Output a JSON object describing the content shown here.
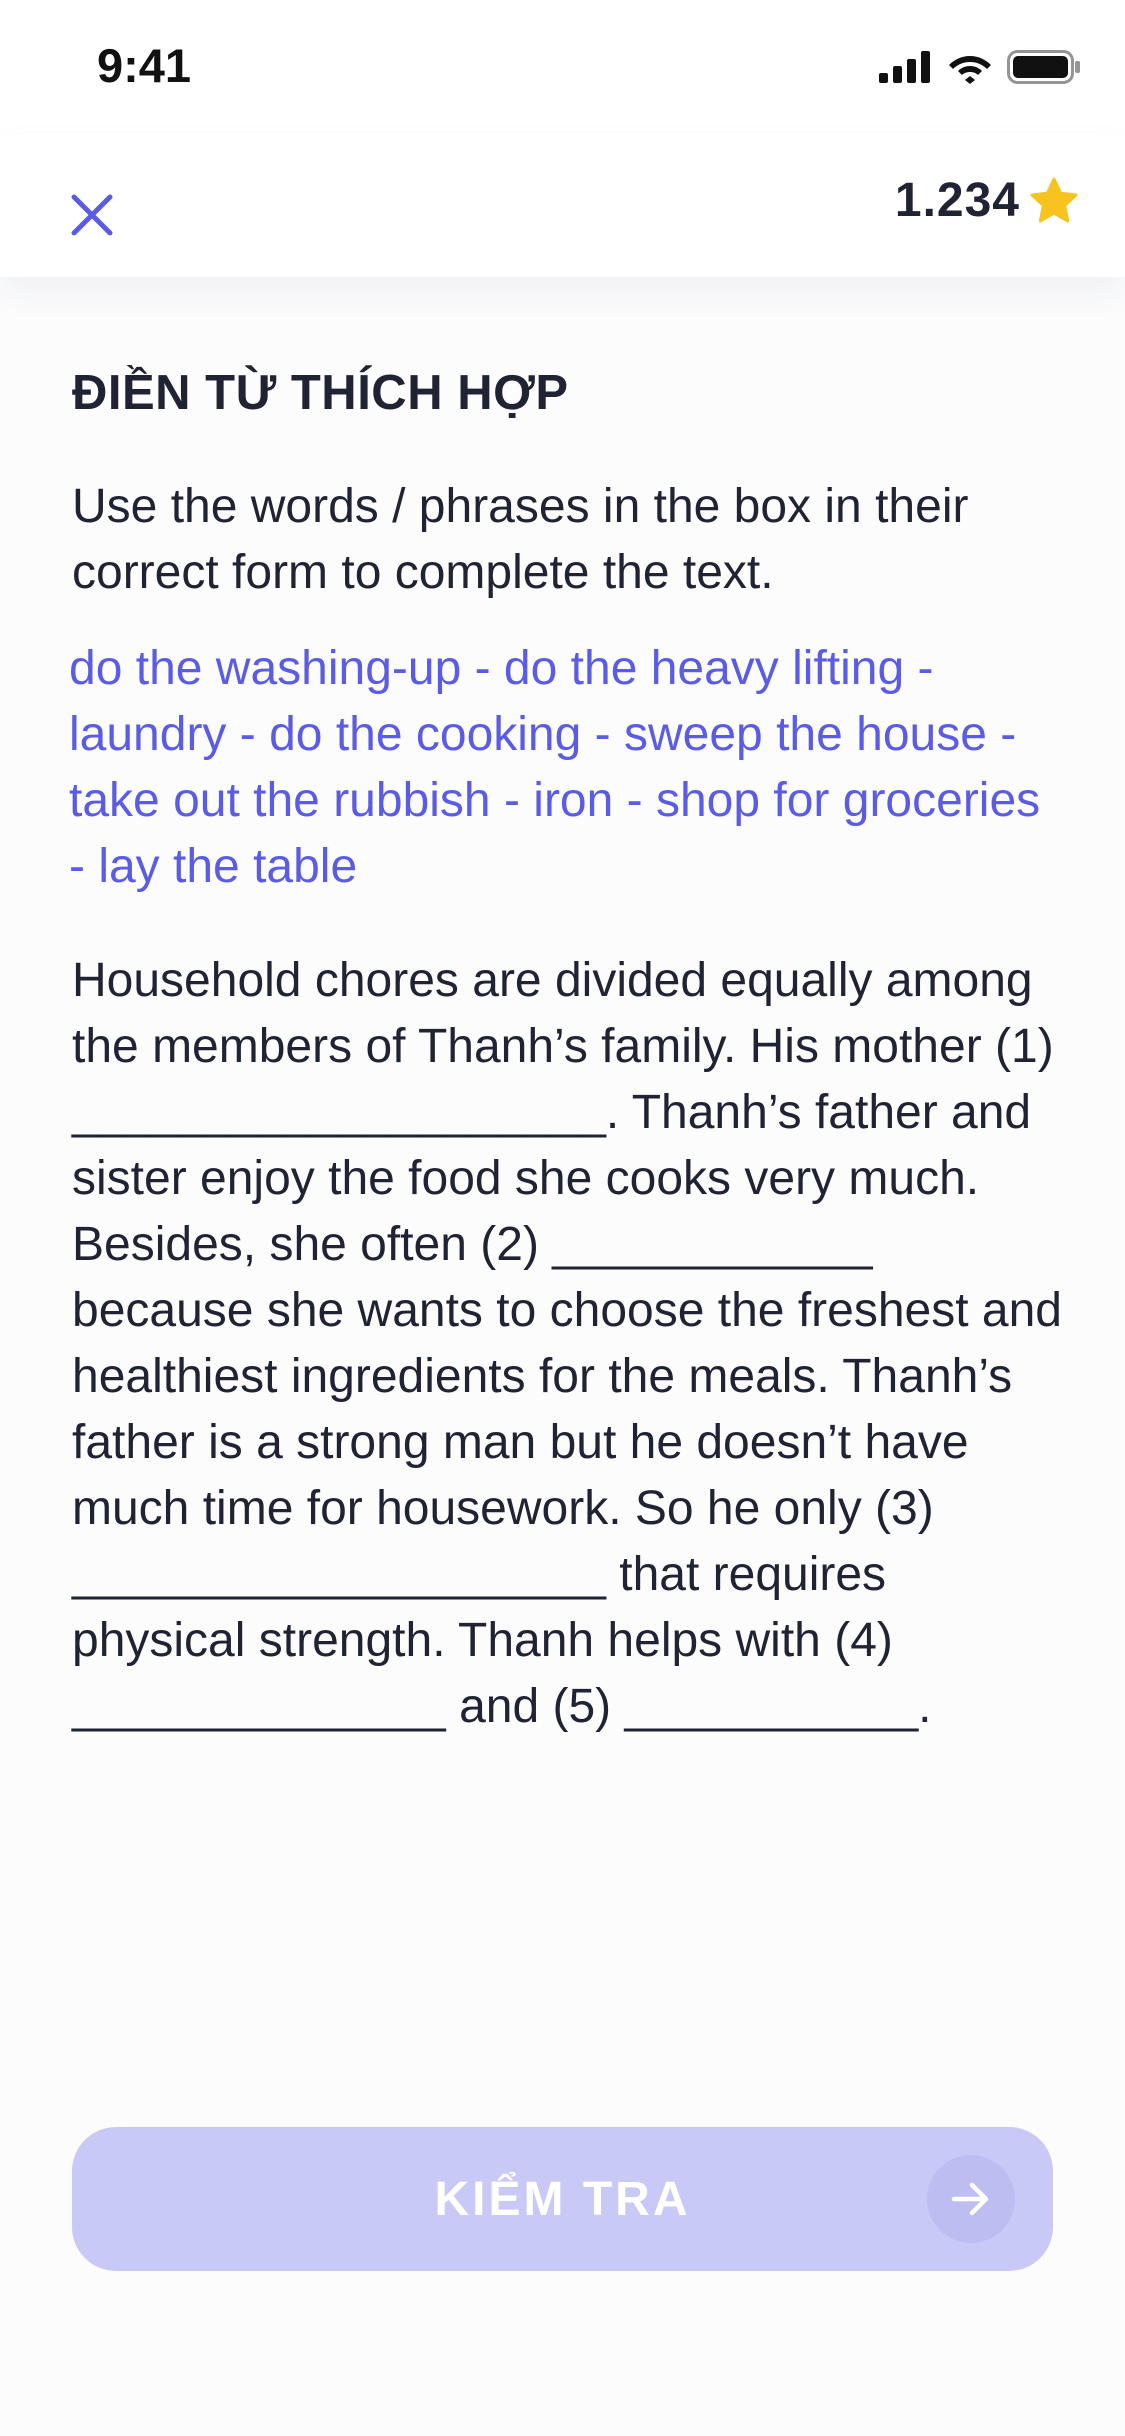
{
  "status_bar": {
    "time": "9:41",
    "icons": [
      "cellular-signal-icon",
      "wifi-icon",
      "battery-icon"
    ]
  },
  "header": {
    "close_icon": "close-icon",
    "score": "1.234",
    "score_icon": "star-icon"
  },
  "exercise": {
    "heading": "ĐIỀN TỪ THÍCH HỢP",
    "instruction": "Use the words / phrases in the box in their correct form to complete the text.",
    "word_box": "do the washing-up - do the heavy lifting - laundry - do the cooking - sweep the house - take out the rubbish - iron - shop for groceries - lay the table",
    "passage": [
      "Household chores are divided equally among the members of Thanh’s family. His mother (1) ",
      "____________________",
      ". Thanh’s father and sister enjoy the food she cooks very much. Besides, she often (2) ",
      "____________",
      " because she wants to choose the freshest and healthiest ingredients for the meals. Thanh’s father is a strong man but he doesn’t have much time for housework. So he only (3) ",
      "____________________",
      " that requires physical strength. Thanh helps with (4) ",
      "______________",
      " and (5) ",
      "___________",
      "."
    ]
  },
  "footer": {
    "check_button_label": "KIỂM TRA",
    "arrow_icon": "arrow-right-icon"
  },
  "colors": {
    "accent": "#5b5ce6",
    "button_disabled": "#c9c9f8",
    "star": "#f7c31e",
    "text": "#1f2333"
  }
}
